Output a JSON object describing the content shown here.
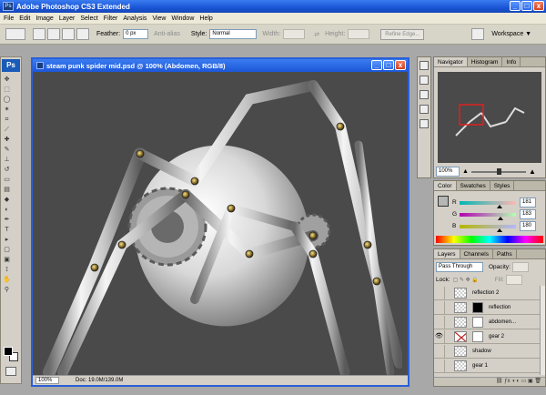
{
  "app": {
    "title": "Adobe Photoshop CS3 Extended",
    "logo": "Ps"
  },
  "window_controls": [
    "_",
    "□",
    "x"
  ],
  "menu": [
    "File",
    "Edit",
    "Image",
    "Layer",
    "Select",
    "Filter",
    "Analysis",
    "View",
    "Window",
    "Help"
  ],
  "options": {
    "feather_label": "Feather:",
    "feather_value": "0 px",
    "antialias_label": "Anti-alias",
    "style_label": "Style:",
    "style_value": "Normal",
    "width_label": "Width:",
    "height_label": "Height:",
    "refine_label": "Refine Edge...",
    "workspace_label": "Workspace ▼"
  },
  "document": {
    "title": "steam punk spider mid.psd @ 100% (Abdomen, RGB/8)",
    "zoom": "100%",
    "doc_info": "Doc: 19.0M/139.0M"
  },
  "navigator": {
    "tabs": [
      "Navigator",
      "Histogram",
      "Info"
    ],
    "zoom": "100%",
    "viewbox_color": "#e02020"
  },
  "color_panel": {
    "tabs": [
      "Color",
      "Swatches",
      "Styles"
    ],
    "channels": [
      {
        "label": "R",
        "value": "181",
        "fill": 0.71
      },
      {
        "label": "G",
        "value": "183",
        "fill": 0.72
      },
      {
        "label": "B",
        "value": "180",
        "fill": 0.71
      }
    ]
  },
  "layers_panel": {
    "tabs": [
      "Layers",
      "Channels",
      "Paths"
    ],
    "blend_mode": "Pass Through",
    "opacity_label": "Opacity:",
    "lock_label": "Lock:",
    "fill_label": "Fill:",
    "layers": [
      {
        "name": "reflection 2",
        "visible": false,
        "mask": false
      },
      {
        "name": "reflection",
        "visible": false,
        "mask": true
      },
      {
        "name": "abdomen...",
        "visible": false,
        "mask": true
      },
      {
        "name": "gear 2",
        "visible": true,
        "mask": true
      },
      {
        "name": "shadow",
        "visible": false,
        "mask": false
      },
      {
        "name": "gear 1",
        "visible": false,
        "mask": false
      }
    ]
  },
  "colors": {
    "titlebar": "#1d57d8",
    "canvas_bg": "#4a4a4a"
  }
}
